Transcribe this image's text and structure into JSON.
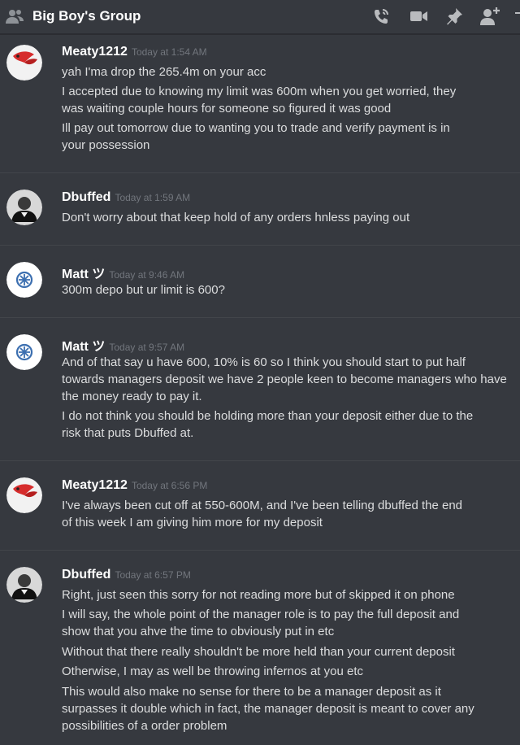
{
  "channel": {
    "title": "Big Boy's Group"
  },
  "header_icons": [
    "call-icon",
    "video-icon",
    "pin-icon",
    "add-member-icon"
  ],
  "messages": [
    {
      "author": "Meaty1212",
      "timestamp": "Today at 1:54 AM",
      "avatar": "red-bird-avatar",
      "lines": [
        "yah I'ma drop the 265.4m on your acc",
        "I accepted due to knowing my limit was 600m when you get worried, they",
        "was waiting couple hours for someone so figured it was good",
        "Ill pay out tomorrow due to wanting you to trade and verify payment is in",
        "your possession"
      ]
    },
    {
      "author": "Dbuffed",
      "timestamp": "Today at 1:59 AM",
      "avatar": "dark-portrait-avatar",
      "lines": [
        "Don't worry about that keep hold of any orders hnless paying out"
      ]
    },
    {
      "author": "Matt ツ",
      "timestamp": "Today at 9:46 AM",
      "avatar": "blue-emblem-avatar",
      "lines": [
        "300m depo but ur limit is 600?"
      ]
    },
    {
      "author": "Matt ツ",
      "timestamp": "Today at 9:57 AM",
      "avatar": "blue-emblem-avatar",
      "lines": [
        "And of that say u have 600, 10% is 60 so I think you should start to put half",
        "towards managers deposit we have 2 people keen to become managers who have",
        "the money ready to pay it.",
        "I do not think you should be holding more than your deposit either due to the",
        "risk that puts Dbuffed at."
      ]
    },
    {
      "author": "Meaty1212",
      "timestamp": "Today at 6:56 PM",
      "avatar": "red-bird-avatar",
      "lines": [
        "I've always been cut off at 550-600M, and I've been telling dbuffed the end",
        "of this week I am giving him more for my deposit"
      ]
    },
    {
      "author": "Dbuffed",
      "timestamp": "Today at 6:57 PM",
      "avatar": "dark-portrait-avatar",
      "lines": [
        "Right, just seen this sorry for not reading more but of skipped it on phone",
        "I will say, the whole point of the manager role is to pay the full deposit and",
        "show that you ahve the time to obviously put in etc",
        "Without that there really shouldn't be more held than your current deposit",
        "Otherwise, I may as well be throwing infernos at you etc",
        "This would also make no sense for there to be a manager deposit as it",
        "surpasses it double which in fact, the manager deposit is meant to cover any",
        "possibilities of a order problem"
      ]
    }
  ]
}
